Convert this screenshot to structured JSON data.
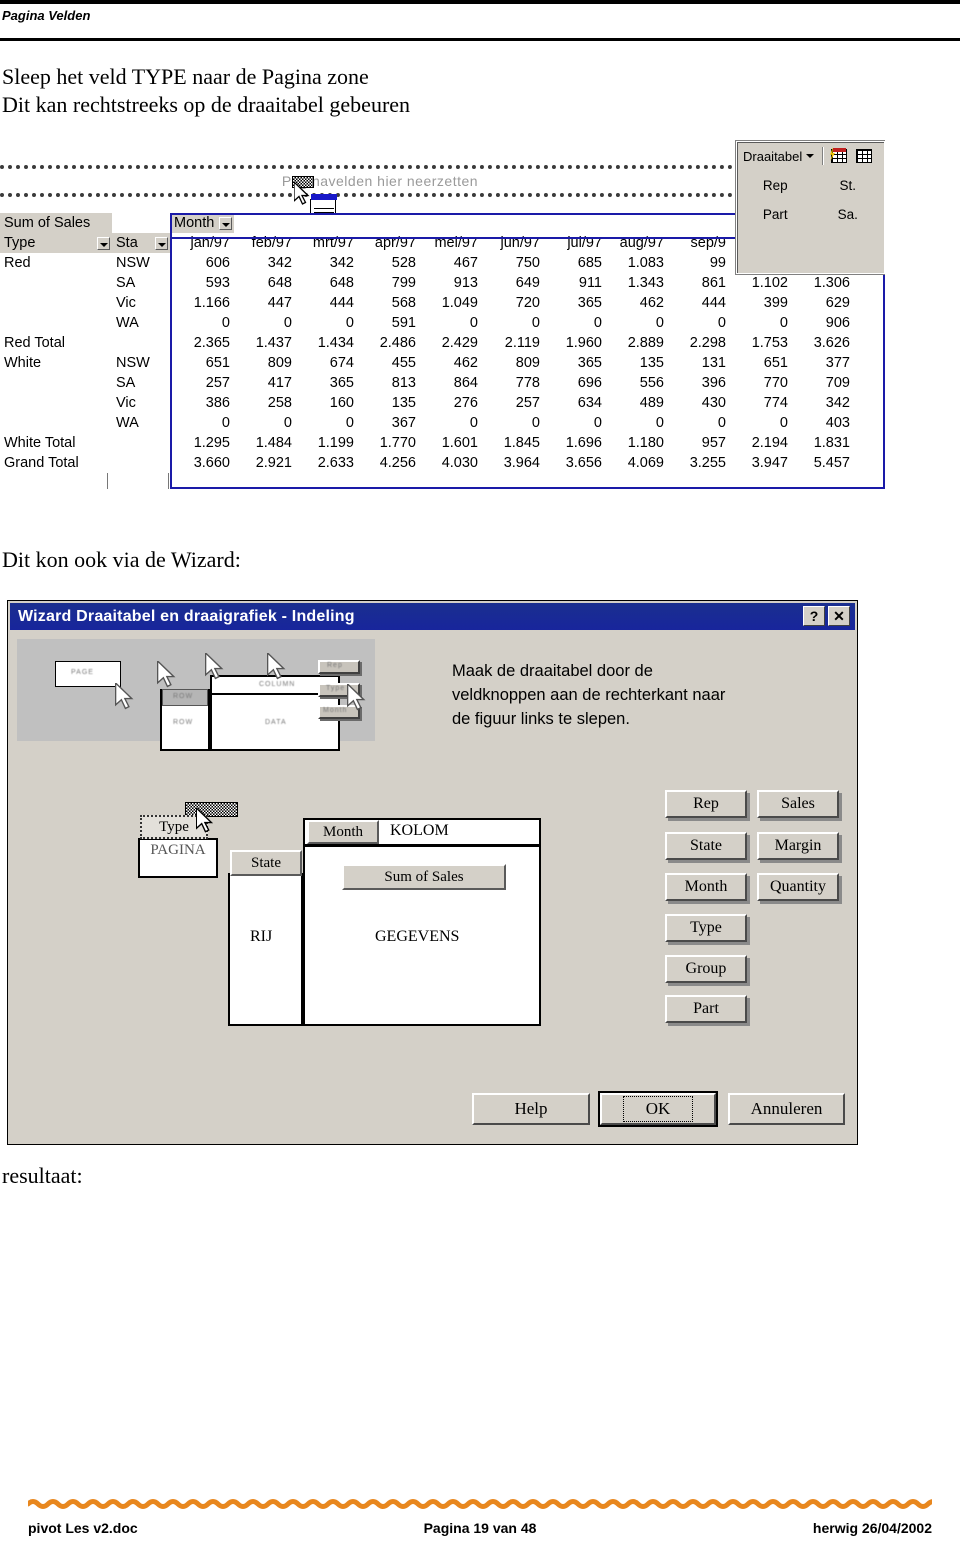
{
  "header": {
    "title": "Pagina Velden"
  },
  "prose": {
    "intro_line1": "Sleep het veld TYPE naar de Pagina zone",
    "intro_line2": "Dit kan rechtstreeks op de draaitabel gebeuren",
    "wizard_lead": "Dit kon ook via de Wizard:",
    "result_lead": "resultaat:"
  },
  "pivot": {
    "dropzone_label": "Paginavelden hier neerzetten",
    "corner_label": "Sum of Sales",
    "row_field_label": "Type",
    "row_field2_label": "Sta",
    "col_field_label": "Month",
    "columns": [
      "jan/97",
      "feb/97",
      "mrt/97",
      "apr/97",
      "mei/97",
      "jun/97",
      "jul/97",
      "aug/97",
      "sep/9",
      "",
      ""
    ],
    "groups": [
      {
        "name": "Red",
        "rows": [
          {
            "state": "NSW",
            "values": [
              "606",
              "342",
              "342",
              "528",
              "467",
              "750",
              "685",
              "1.083",
              "99",
              "",
              ""
            ]
          },
          {
            "state": "SA",
            "values": [
              "593",
              "648",
              "648",
              "799",
              "913",
              "649",
              "911",
              "1.343",
              "861",
              "1.102",
              "1.306"
            ]
          },
          {
            "state": "Vic",
            "values": [
              "1.166",
              "447",
              "444",
              "568",
              "1.049",
              "720",
              "365",
              "462",
              "444",
              "399",
              "629"
            ]
          },
          {
            "state": "WA",
            "values": [
              "0",
              "0",
              "0",
              "591",
              "0",
              "0",
              "0",
              "0",
              "0",
              "0",
              "906"
            ]
          }
        ],
        "total_label": "Red Total",
        "totals": [
          "2.365",
          "1.437",
          "1.434",
          "2.486",
          "2.429",
          "2.119",
          "1.960",
          "2.889",
          "2.298",
          "1.753",
          "3.626"
        ]
      },
      {
        "name": "White",
        "rows": [
          {
            "state": "NSW",
            "values": [
              "651",
              "809",
              "674",
              "455",
              "462",
              "809",
              "365",
              "135",
              "131",
              "651",
              "377"
            ]
          },
          {
            "state": "SA",
            "values": [
              "257",
              "417",
              "365",
              "813",
              "864",
              "778",
              "696",
              "556",
              "396",
              "770",
              "709"
            ]
          },
          {
            "state": "Vic",
            "values": [
              "386",
              "258",
              "160",
              "135",
              "276",
              "257",
              "634",
              "489",
              "430",
              "774",
              "342"
            ]
          },
          {
            "state": "WA",
            "values": [
              "0",
              "0",
              "0",
              "367",
              "0",
              "0",
              "0",
              "0",
              "0",
              "0",
              "403"
            ]
          }
        ],
        "total_label": "White Total",
        "totals": [
          "1.295",
          "1.484",
          "1.199",
          "1.770",
          "1.601",
          "1.845",
          "1.696",
          "1.180",
          "957",
          "2.194",
          "1.831"
        ]
      }
    ],
    "grand_total_label": "Grand Total",
    "grand_totals": [
      "3.660",
      "2.921",
      "2.633",
      "4.256",
      "4.030",
      "3.964",
      "3.656",
      "4.069",
      "3.255",
      "3.947",
      "5.457"
    ],
    "toolbar": {
      "menu_label": "Draaitabel",
      "fields": [
        "Rep",
        "St.",
        "Part",
        "Sa."
      ]
    }
  },
  "wizard": {
    "title": "Wizard Draaitabel en draaigrafiek - Indeling",
    "help_btn": "?",
    "close_btn": "✕",
    "instruction": "Maak de draaitabel door de\nveldknoppen aan de rechterkant naar\nde figuur links te slepen.",
    "layout": {
      "page_zone": "PAGINA",
      "column_zone": "KOLOM",
      "row_zone": "RIJ",
      "data_zone": "GEGEVENS",
      "page_field": "Type",
      "column_field": "Month",
      "row_field": "State",
      "data_field": "Sum of Sales"
    },
    "field_buttons_left": [
      "Rep",
      "State",
      "Month",
      "Type",
      "Group",
      "Part"
    ],
    "field_buttons_right": [
      "Sales",
      "Margin",
      "Quantity"
    ],
    "buttons": {
      "help": "Help",
      "ok": "OK",
      "cancel": "Annuleren"
    }
  },
  "footer": {
    "left": "pivot Les v2.doc",
    "center": "Pagina 19 van 48",
    "right": "herwig 26/04/2002",
    "rule_color": "#e8871e"
  }
}
